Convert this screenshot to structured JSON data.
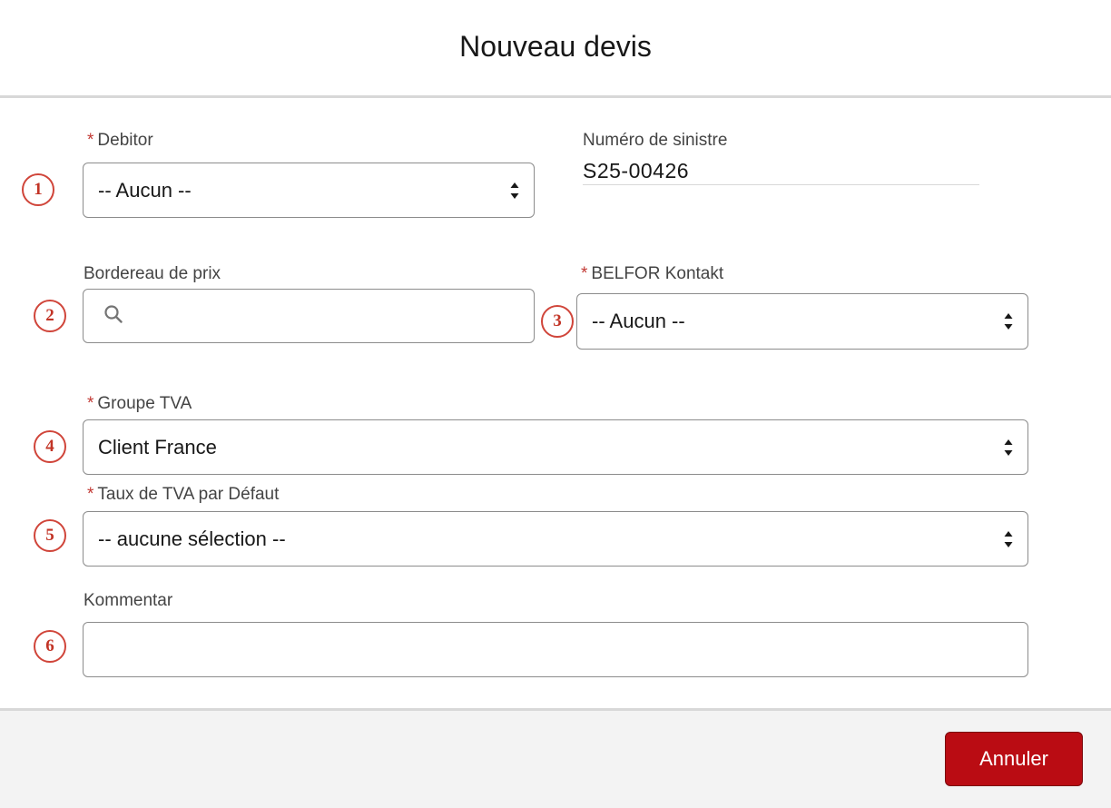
{
  "modal": {
    "title": "Nouveau devis"
  },
  "fields": {
    "debitor": {
      "label": "Debitor",
      "required_marker": "*",
      "value": "-- Aucun --",
      "badge": "1"
    },
    "claim_number": {
      "label": "Numéro de sinistre",
      "value": "S25-00426"
    },
    "price_schedule": {
      "label": "Bordereau de prix",
      "value": "",
      "placeholder": "",
      "badge": "2"
    },
    "belfor_contact": {
      "label": "BELFOR Kontakt",
      "required_marker": "*",
      "value": "-- Aucun --",
      "badge": "3"
    },
    "vat_group": {
      "label": "Groupe TVA",
      "required_marker": "*",
      "value": "Client France",
      "badge": "4"
    },
    "default_vat_rate": {
      "label": "Taux de TVA par Défaut",
      "required_marker": "*",
      "value": "-- aucune sélection --",
      "badge": "5"
    },
    "comment": {
      "label": "Kommentar",
      "value": "",
      "badge": "6"
    }
  },
  "footer": {
    "cancel_label": "Annuler"
  },
  "colors": {
    "required": "#c23934",
    "badge": "#d0453a",
    "cancel_button": "#ba0c13",
    "footer_bg": "#f3f3f3",
    "border": "#8c8c8c"
  }
}
